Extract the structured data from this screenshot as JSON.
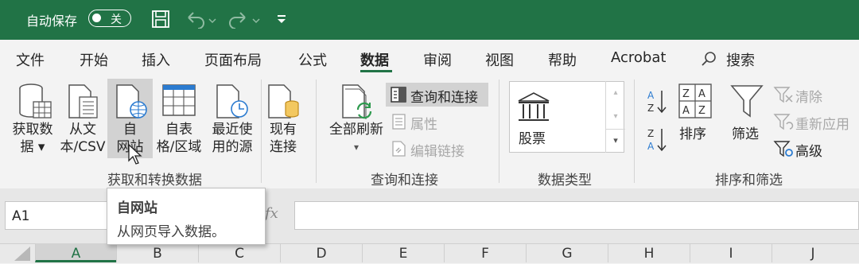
{
  "titlebar": {
    "autosave_label": "自动保存",
    "autosave_state": "关"
  },
  "menu": {
    "tabs": [
      "文件",
      "开始",
      "插入",
      "页面布局",
      "公式",
      "数据",
      "审阅",
      "视图",
      "帮助",
      "Acrobat"
    ],
    "active_tab": "数据",
    "search_label": "搜索"
  },
  "ribbon": {
    "get_transform": {
      "label": "获取和转换数据",
      "get_data": [
        "获取数",
        "据 ▾"
      ],
      "from_text": [
        "从文",
        "本/CSV"
      ],
      "from_web": [
        "自",
        "网站"
      ],
      "from_table": [
        "自表",
        "格/区域"
      ],
      "recent_sources": [
        "最近使",
        "用的源"
      ],
      "existing_connections": [
        "现有",
        "连接"
      ]
    },
    "queries": {
      "label": "查询和连接",
      "refresh_all": "全部刷新",
      "queries_connections": "查询和连接",
      "properties": "属性",
      "edit_links": "编辑链接"
    },
    "data_types": {
      "label": "数据类型",
      "stocks": "股票"
    },
    "sort_filter": {
      "label": "排序和筛选",
      "sort": "排序",
      "filter": "筛选",
      "clear": "清除",
      "reapply": "重新应用",
      "advanced": "高级"
    }
  },
  "formula_bar": {
    "name_box": "A1",
    "fx": "fx"
  },
  "tooltip": {
    "title": "自网站",
    "description": "从网页导入数据。"
  },
  "columns": [
    "A",
    "B",
    "C",
    "D",
    "E",
    "F",
    "G",
    "H",
    "I",
    "J"
  ],
  "colors": {
    "brand_green": "#217346"
  }
}
